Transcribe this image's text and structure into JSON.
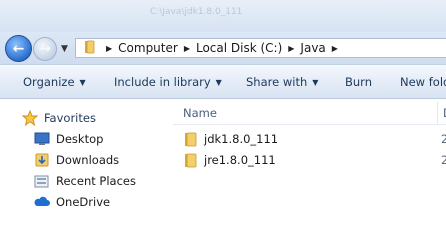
{
  "window": {
    "title": "C:\\Java\\jdk1.8.0_111"
  },
  "address": {
    "crumbs": [
      "Computer",
      "Local Disk (C:)",
      "Java"
    ]
  },
  "toolbar": {
    "organize": "Organize",
    "include_in_library": "Include in library",
    "share_with": "Share with",
    "burn": "Burn",
    "new_folder": "New folder"
  },
  "nav": {
    "favorites": "Favorites",
    "items": [
      "Desktop",
      "Downloads",
      "Recent Places",
      "OneDrive"
    ]
  },
  "content": {
    "columns": {
      "name": "Name",
      "date": "D"
    },
    "rows": [
      {
        "name": "jdk1.8.0_111",
        "date": "2"
      },
      {
        "name": "jre1.8.0_111",
        "date": "2"
      }
    ]
  }
}
